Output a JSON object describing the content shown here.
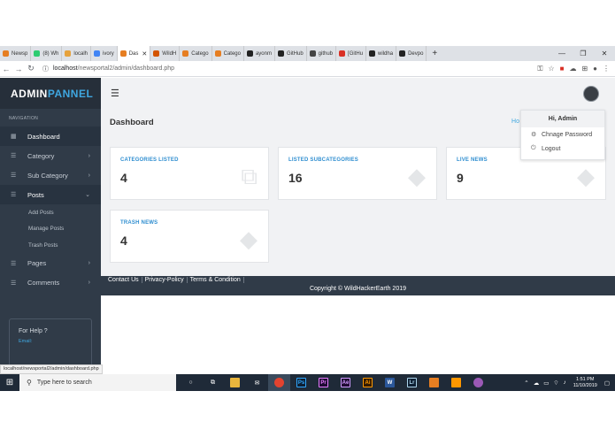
{
  "browser": {
    "tabs": [
      {
        "label": "Newsp",
        "color": "#e67e22"
      },
      {
        "label": "(8) Wh",
        "color": "#2ecc71"
      },
      {
        "label": "localh",
        "color": "#e6a23c"
      },
      {
        "label": "ivory",
        "color": "#4285f4"
      },
      {
        "label": "Das",
        "color": "#e67e22",
        "active": true
      },
      {
        "label": "WildH",
        "color": "#d35400"
      },
      {
        "label": "Catego",
        "color": "#e67e22"
      },
      {
        "label": "Catego",
        "color": "#e67e22"
      },
      {
        "label": "ayonm",
        "color": "#222222"
      },
      {
        "label": "GitHub",
        "color": "#222222"
      },
      {
        "label": "github",
        "color": "#444444"
      },
      {
        "label": "[GitHu",
        "color": "#d93025"
      },
      {
        "label": "wildha",
        "color": "#222222"
      },
      {
        "label": "Devpo",
        "color": "#222222"
      }
    ],
    "url_host": "localhost",
    "url_path": "/newsportal2/admin/dashboard.php",
    "status_url": "localhost/newsportal2/admin/dashboard.php"
  },
  "sidebar": {
    "brand_a": "ADMIN",
    "brand_b": "PANNEL",
    "nav_label": "NAVIGATION",
    "items": [
      {
        "label": "Dashboard",
        "icon": "dashboard-icon"
      },
      {
        "label": "Category",
        "icon": "list-icon"
      },
      {
        "label": "Sub Category",
        "icon": "list-icon"
      },
      {
        "label": "Posts",
        "icon": "list-icon"
      },
      {
        "label": "Pages",
        "icon": "list-icon"
      },
      {
        "label": "Comments",
        "icon": "list-icon"
      }
    ],
    "post_subitems": [
      "Add Posts",
      "Manage Posts",
      "Trash Posts"
    ],
    "help_title": "For Help ?",
    "help_email_label": "Email:"
  },
  "main": {
    "page_title": "Dashboard",
    "home_link": "Ho",
    "cards": [
      {
        "label": "CATEGORIES LISTED",
        "value": "4"
      },
      {
        "label": "LISTED SUBCATEGORIES",
        "value": "16"
      },
      {
        "label": "LIVE NEWS",
        "value": "9"
      },
      {
        "label": "TRASH NEWS",
        "value": "4"
      }
    ],
    "footer_links": [
      "Contact Us",
      "Privacy-Policy",
      "Terms & Condition"
    ],
    "copyright": "Copyright © WildHackerEarth 2019"
  },
  "dropdown": {
    "greeting": "Hi, Admin",
    "change_password": "Chnage Password",
    "logout": "Logout"
  },
  "taskbar": {
    "search_placeholder": "Type here to search",
    "time": "1:51 PM",
    "date": "11/10/2019"
  }
}
